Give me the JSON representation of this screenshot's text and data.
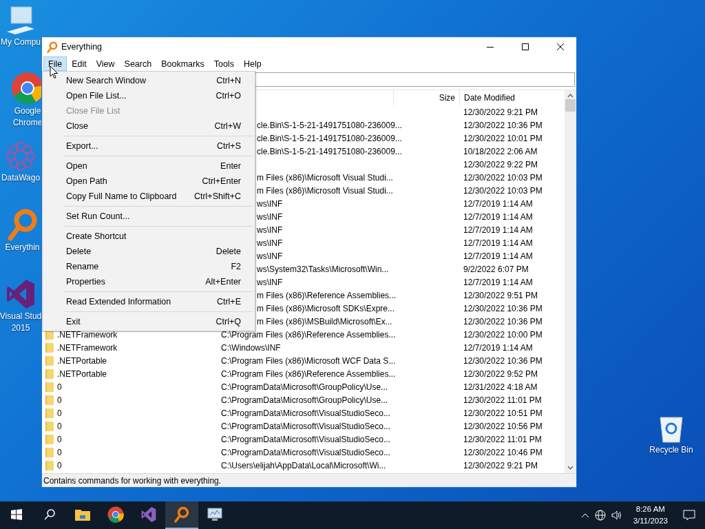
{
  "desktop_icons": [
    {
      "kind": "computer",
      "lines": [
        "My Compu"
      ]
    },
    {
      "kind": "chrome",
      "lines": [
        "Google",
        "Chrome"
      ]
    },
    {
      "kind": "network",
      "lines": [
        "DataWago"
      ]
    },
    {
      "kind": "everything",
      "lines": [
        "Everythin"
      ]
    },
    {
      "kind": "vs",
      "lines": [
        "Visual Stud",
        "2015"
      ]
    },
    {
      "kind": "recycle",
      "lines": [
        "Recycle Bin"
      ]
    }
  ],
  "window": {
    "title": "Everything"
  },
  "menu_bar": [
    {
      "label": "File",
      "selected": true
    },
    {
      "label": "Edit",
      "selected": false
    },
    {
      "label": "View",
      "selected": false
    },
    {
      "label": "Search",
      "selected": false
    },
    {
      "label": "Bookmarks",
      "selected": false
    },
    {
      "label": "Tools",
      "selected": false
    },
    {
      "label": "Help",
      "selected": false
    }
  ],
  "file_menu": [
    {
      "kind": "item",
      "label": "New Search Window",
      "shortcut": "Ctrl+N",
      "disabled": false
    },
    {
      "kind": "item",
      "label": "Open File List...",
      "shortcut": "Ctrl+O",
      "disabled": false
    },
    {
      "kind": "item",
      "label": "Close File List",
      "disabled": true
    },
    {
      "kind": "item",
      "label": "Close",
      "shortcut": "Ctrl+W",
      "disabled": false
    },
    {
      "kind": "separator"
    },
    {
      "kind": "item",
      "label": "Export...",
      "shortcut": "Ctrl+S",
      "disabled": false
    },
    {
      "kind": "separator"
    },
    {
      "kind": "item",
      "label": "Open",
      "shortcut": "Enter",
      "disabled": false
    },
    {
      "kind": "item",
      "label": "Open Path",
      "shortcut": "Ctrl+Enter",
      "disabled": false
    },
    {
      "kind": "item",
      "label": "Copy Full Name to Clipboard",
      "shortcut": "Ctrl+Shift+C",
      "disabled": false
    },
    {
      "kind": "separator"
    },
    {
      "kind": "item",
      "label": "Set Run Count...",
      "disabled": false
    },
    {
      "kind": "separator"
    },
    {
      "kind": "item",
      "label": "Create Shortcut",
      "disabled": false
    },
    {
      "kind": "item",
      "label": "Delete",
      "shortcut": "Delete",
      "disabled": false
    },
    {
      "kind": "item",
      "label": "Rename",
      "shortcut": "F2",
      "disabled": false
    },
    {
      "kind": "item",
      "label": "Properties",
      "shortcut": "Alt+Enter",
      "disabled": false
    },
    {
      "kind": "separator"
    },
    {
      "kind": "item",
      "label": "Read Extended Information",
      "shortcut": "Ctrl+E",
      "disabled": false
    },
    {
      "kind": "separator"
    },
    {
      "kind": "item",
      "label": "Exit",
      "shortcut": "Ctrl+Q",
      "disabled": false
    }
  ],
  "table": {
    "columns": [
      "Size",
      "Date Modified"
    ],
    "rows": [
      {
        "date": "12/30/2022 9:21 PM"
      },
      {
        "path": "cle.Bin\\S-1-5-21-1491751080-236009...",
        "date": "12/30/2022 10:36 PM"
      },
      {
        "path": "cle.Bin\\S-1-5-21-1491751080-236009...",
        "date": "12/30/2022 10:01 PM"
      },
      {
        "path": "cle.Bin\\S-1-5-21-1491751080-236009...",
        "date": "10/18/2022 2:06 AM"
      },
      {
        "date": "12/30/2022 9:22 PM"
      },
      {
        "path": "m Files (x86)\\Microsoft Visual Studi...",
        "date": "12/30/2022 10:03 PM"
      },
      {
        "path": "m Files (x86)\\Microsoft Visual Studi...",
        "date": "12/30/2022 10:03 PM"
      },
      {
        "path": "ws\\INF",
        "date": "12/7/2019 1:14 AM"
      },
      {
        "path": "ws\\INF",
        "date": "12/7/2019 1:14 AM"
      },
      {
        "path": "ws\\INF",
        "date": "12/7/2019 1:14 AM"
      },
      {
        "path": "ws\\INF",
        "date": "12/7/2019 1:14 AM"
      },
      {
        "path": "ws\\INF",
        "date": "12/7/2019 1:14 AM"
      },
      {
        "path": "ws\\System32\\Tasks\\Microsoft\\Win...",
        "date": "9/2/2022 6:07 PM"
      },
      {
        "path": "ws\\INF",
        "date": "12/7/2019 1:14 AM"
      },
      {
        "path": "m Files (x86)\\Reference Assemblies...",
        "date": "12/30/2022 9:51 PM"
      },
      {
        "path": "m Files (x86)\\Microsoft SDKs\\Expre...",
        "date": "12/30/2022 10:36 PM"
      },
      {
        "path": "m Files (x86)\\MSBuild\\Microsoft\\Ex...",
        "date": "12/30/2022 10:36 PM"
      },
      {
        "name": ".NETFramework",
        "path": "C:\\Program Files (x86)\\Reference Assemblies...",
        "date": "12/30/2022 10:00 PM"
      },
      {
        "name": ".NETFramework",
        "path": "C:\\Windows\\INF",
        "date": "12/7/2019 1:14 AM"
      },
      {
        "name": ".NETPortable",
        "path": "C:\\Program Files (x86)\\Microsoft WCF Data S...",
        "date": "12/30/2022 10:36 PM"
      },
      {
        "name": ".NETPortable",
        "path": "C:\\Program Files (x86)\\Reference Assemblies...",
        "date": "12/30/2022 9:52 PM"
      },
      {
        "name": "0",
        "path": "C:\\ProgramData\\Microsoft\\GroupPolicy\\Use...",
        "date": "12/31/2022 4:18 AM"
      },
      {
        "name": "0",
        "path": "C:\\ProgramData\\Microsoft\\GroupPolicy\\Use...",
        "date": "12/30/2022 11:01 PM"
      },
      {
        "name": "0",
        "path": "C:\\ProgramData\\Microsoft\\VisualStudioSeco...",
        "date": "12/30/2022 10:51 PM"
      },
      {
        "name": "0",
        "path": "C:\\ProgramData\\Microsoft\\VisualStudioSeco...",
        "date": "12/30/2022 10:56 PM"
      },
      {
        "name": "0",
        "path": "C:\\ProgramData\\Microsoft\\VisualStudioSeco...",
        "date": "12/30/2022 11:01 PM"
      },
      {
        "name": "0",
        "path": "C:\\ProgramData\\Microsoft\\VisualStudioSeco...",
        "date": "12/30/2022 10:46 PM"
      },
      {
        "name": "0",
        "path": "C:\\Users\\elijah\\AppData\\Local\\Microsoft\\Wi...",
        "date": "12/30/2022 9:21 PM"
      }
    ]
  },
  "status_bar": "Contains commands for working with everything.",
  "taskbar": [
    {
      "kind": "start",
      "selected": false
    },
    {
      "kind": "search",
      "selected": false
    },
    {
      "kind": "explorer",
      "selected": false
    },
    {
      "kind": "chrome",
      "selected": false
    },
    {
      "kind": "vs",
      "selected": false
    },
    {
      "kind": "everything",
      "selected": true
    },
    {
      "kind": "monitor",
      "selected": false
    }
  ],
  "clock": {
    "time": "8:26 AM",
    "date": "3/11/2023"
  }
}
